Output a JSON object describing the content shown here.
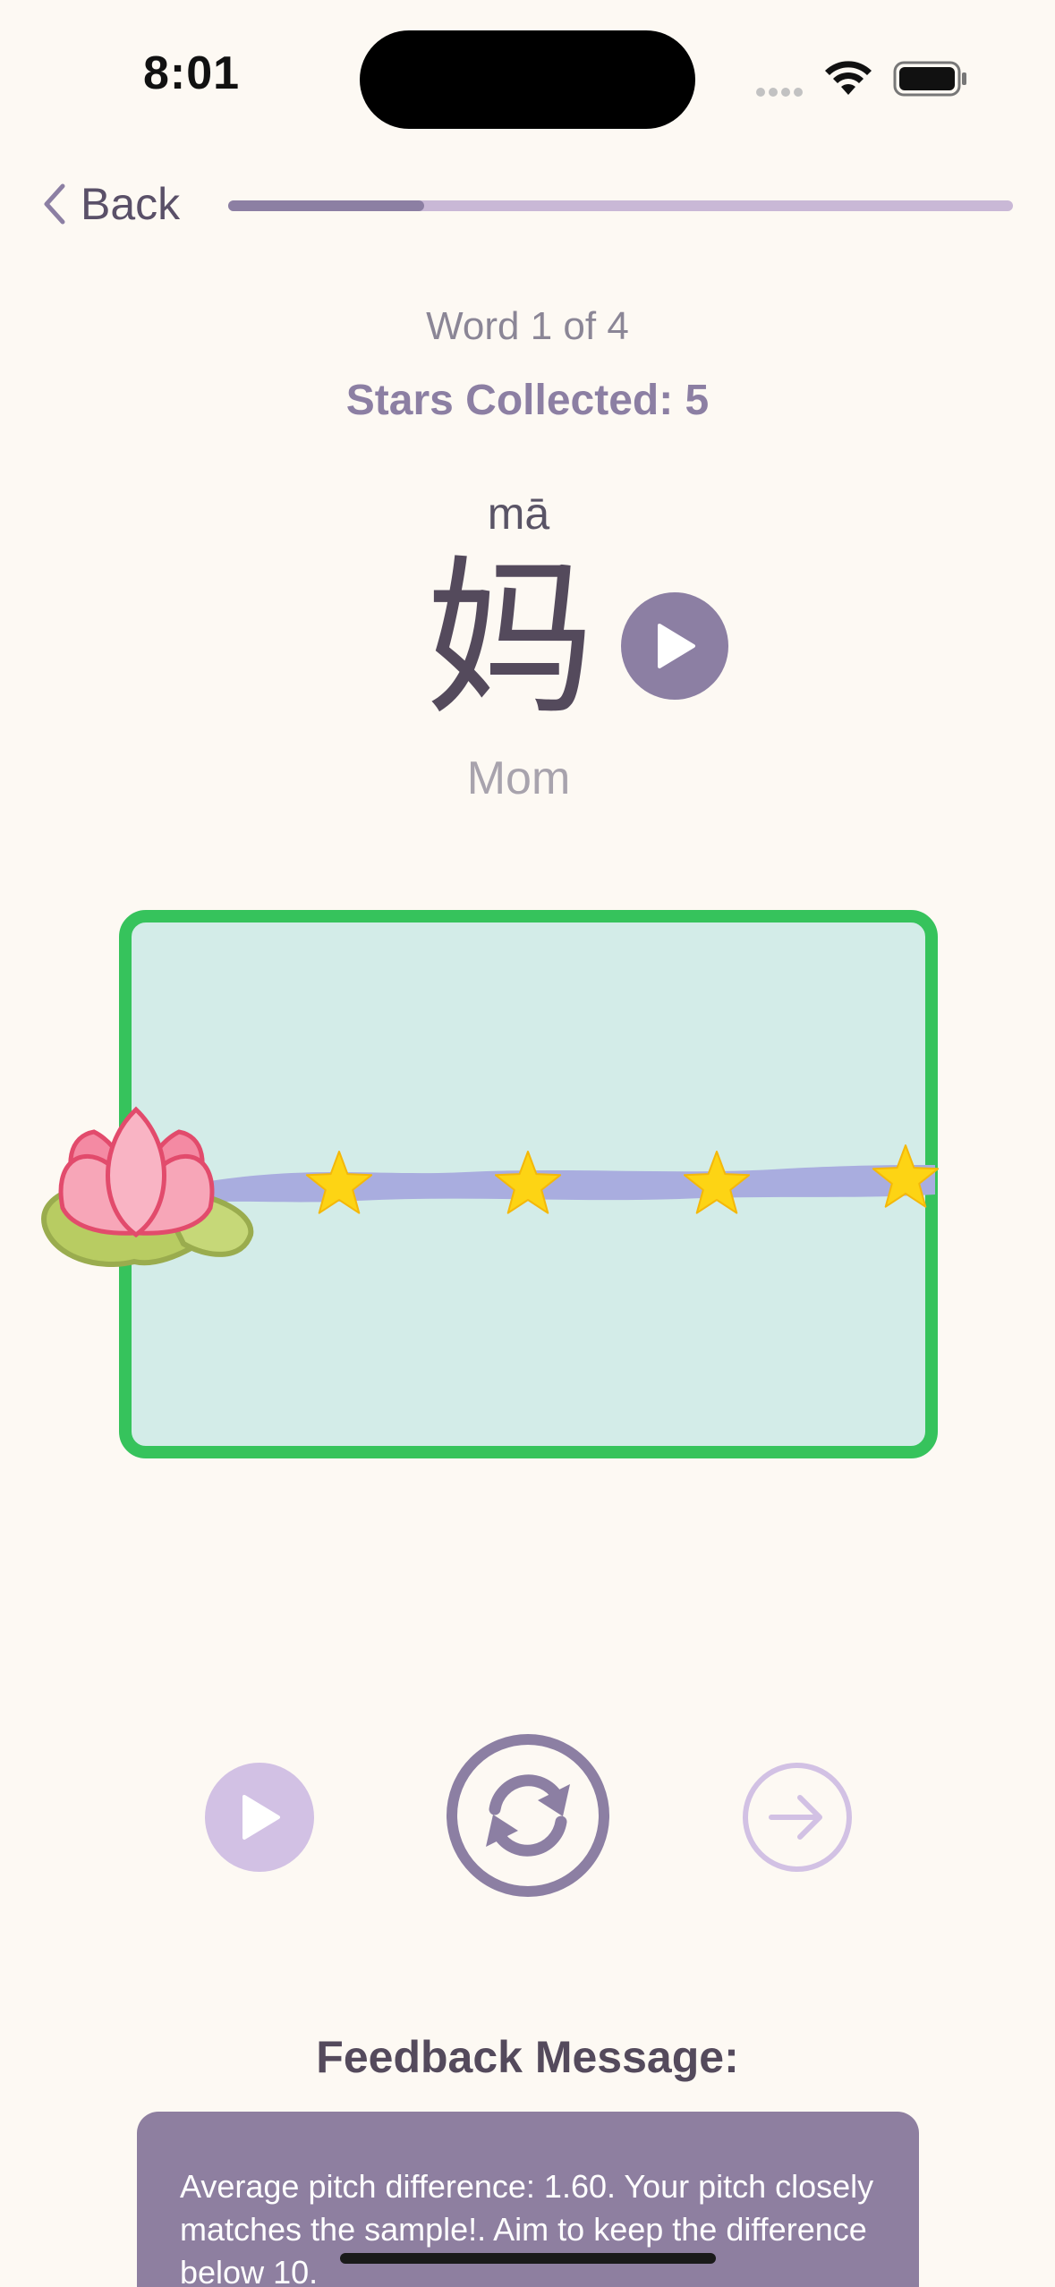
{
  "status_bar": {
    "time": "8:01"
  },
  "nav": {
    "back_label": "Back",
    "progress": 0.25
  },
  "word": {
    "counter": "Word 1 of 4",
    "stars_collected": "Stars Collected: 5",
    "pinyin": "mā",
    "hanzi": "妈",
    "meaning": "Mom"
  },
  "pitch_game": {
    "icon": "lotus-on-lily-pad",
    "stars": 5,
    "colors": {
      "border": "#36c35c",
      "background": "#d3ece8",
      "pitch_line": "#a9addf",
      "star": "#fdd414"
    }
  },
  "feedback": {
    "title": "Feedback Message:",
    "message": "Average pitch difference: 1.60. Your pitch closely matches the sample!. Aim to keep the difference below 10."
  },
  "colors": {
    "accent": "#8c7fa3",
    "accent_light": "#d2c1e4",
    "text_dark": "#544a5c",
    "page_background": "#fdf9f3"
  }
}
